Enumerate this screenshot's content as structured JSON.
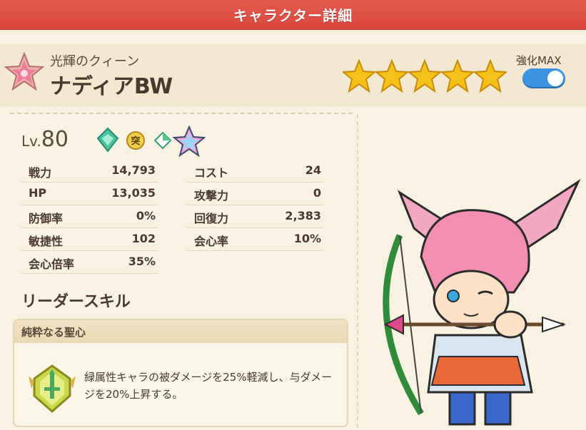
{
  "header": {
    "title": "キャラクター詳細"
  },
  "character": {
    "subtitle": "光輝のクィーン",
    "name": "ナディアBW",
    "star_count": 5,
    "max_label": "強化MAX",
    "max_toggle_on": true,
    "level_prefix": "Lv.",
    "level": "80"
  },
  "attributes": [
    "green-element-icon",
    "breakthrough-icon",
    "white-diamond-icon",
    "rainbow-star-icon"
  ],
  "breakthrough_glyph": "突",
  "stats_left": [
    {
      "label": "戦力",
      "value": "14,793"
    },
    {
      "label": "HP",
      "value": "13,035"
    },
    {
      "label": "防御率",
      "value": "0%"
    },
    {
      "label": "敏捷性",
      "value": "102"
    },
    {
      "label": "会心倍率",
      "value": "35%"
    }
  ],
  "stats_right": [
    {
      "label": "コスト",
      "value": "24"
    },
    {
      "label": "攻撃力",
      "value": "0"
    },
    {
      "label": "回復力",
      "value": "2,383"
    },
    {
      "label": "会心率",
      "value": "10%"
    }
  ],
  "leader_skill": {
    "heading": "リーダースキル",
    "name": "純粋なる聖心",
    "description": "緑属性キャラの被ダメージを25%軽減し、与ダメージを20%上昇する。",
    "icon": "green-sword-shield-icon"
  },
  "colors": {
    "header": "#d9463d",
    "toggle": "#3b95e0",
    "star": "#f5c21a"
  }
}
